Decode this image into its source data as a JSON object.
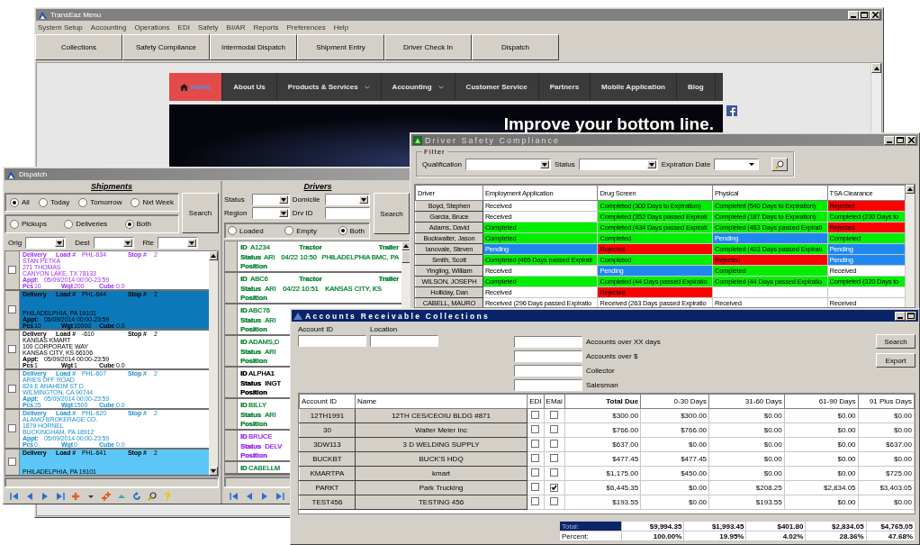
{
  "main_window": {
    "title": "TransEaz Menu",
    "menu": [
      "System Setup",
      "Accounting",
      "Operations",
      "EDI",
      "Safety",
      "BI/AR",
      "Reports",
      "Preferences",
      "Help"
    ],
    "toolbar": [
      "Collections",
      "Safety Compliance",
      "Intermodal Dispatch",
      "Shipment Entry",
      "Driver Check In",
      "Dispatch"
    ],
    "website": {
      "nav": [
        {
          "label": "Home",
          "selected": true,
          "dropdown": false
        },
        {
          "label": "About Us",
          "selected": false,
          "dropdown": false
        },
        {
          "label": "Products & Services",
          "selected": false,
          "dropdown": true
        },
        {
          "label": "Accounting",
          "selected": false,
          "dropdown": true
        },
        {
          "label": "Customer Service",
          "selected": false,
          "dropdown": false
        },
        {
          "label": "Partners",
          "selected": false,
          "dropdown": false
        },
        {
          "label": "Mobile Application",
          "selected": false,
          "dropdown": false
        },
        {
          "label": "Blog",
          "selected": false,
          "dropdown": false
        }
      ],
      "banner_text": "Improve your bottom line."
    }
  },
  "dispatch": {
    "title": "Dispatch",
    "shipments": {
      "heading": "Shipments",
      "date_options": [
        {
          "label": "All",
          "selected": true
        },
        {
          "label": "Today",
          "selected": false
        },
        {
          "label": "Tomorrow",
          "selected": false
        },
        {
          "label": "Nxt Week",
          "selected": false
        }
      ],
      "type_options": [
        {
          "label": "Pickups",
          "selected": false
        },
        {
          "label": "Deliveries",
          "selected": false
        },
        {
          "label": "Both",
          "selected": true
        }
      ],
      "search_button": "Search",
      "filters": [
        "Orig",
        "Dest",
        "Rte"
      ],
      "rows": [
        {
          "color": "#9b2ff0",
          "selected": false,
          "flagged": false,
          "checked": false,
          "type": "Delivery",
          "load_label": "Load #",
          "load": "PHL-634",
          "stop_label": "Stop #",
          "stop": "2",
          "address": [
            "STAN PETKA",
            "271 THOMAS",
            "CANYON LAKE, TX 78133"
          ],
          "appt_label": "Appt:",
          "appt": "05/09/2014 00:00-23:59",
          "pcs_label": "Pcs",
          "pcs": "10",
          "wgt_label": "Wgt",
          "wgt": "200",
          "cube_label": "Cube",
          "cube": "0.0"
        },
        {
          "selected": true,
          "flagged": false,
          "checked": false,
          "type": "Delivery",
          "load_label": "Load #",
          "load": "PHL-644",
          "stop_label": "Stop #",
          "stop": "2",
          "address": [
            "PHILADELPHIA, PA 19101"
          ],
          "appt_label": "Appt:",
          "appt": "05/09/2014 00:00-23:59",
          "pcs_label": "Pcs",
          "pcs": "10",
          "wgt_label": "Wgt",
          "wgt": "10000",
          "cube_label": "Cube",
          "cube": "0.0"
        },
        {
          "color": "#000000",
          "selected": false,
          "flagged": false,
          "checked": false,
          "type": "Delivery",
          "load_label": "Load #",
          "load": "-610",
          "stop_label": "Stop #",
          "stop": "2",
          "address": [
            "KANSAS KMART",
            "100 CORPORATE WAY",
            "KANSAS CITY, KS 66106"
          ],
          "appt_label": "Appt:",
          "appt": "05/09/2014 00:00-23:59",
          "pcs_label": "Pcs",
          "pcs": "1",
          "wgt_label": "Wgt",
          "wgt": "1",
          "cube_label": "Cube",
          "cube": "0.0"
        },
        {
          "color": "#1c8fd0",
          "selected": false,
          "flagged": false,
          "checked": false,
          "type": "Delivery",
          "load_label": "Load #",
          "load": "PHL-607",
          "stop_label": "Stop #",
          "stop": "2",
          "address": [
            "ARIES OFF ROAD",
            "824 E ANAHEIM ST D",
            "WILMINGTON, CA 90744"
          ],
          "appt_label": "Appt:",
          "appt": "05/09/2014 00:00-23:59",
          "pcs_label": "Pcs",
          "pcs": "25",
          "wgt_label": "Wgt",
          "wgt": "1500",
          "cube_label": "Cube",
          "cube": "0.0"
        },
        {
          "color": "#1c8fd0",
          "selected": false,
          "flagged": false,
          "checked": false,
          "type": "Delivery",
          "load_label": "Load #",
          "load": "PHL-620",
          "stop_label": "Stop #",
          "stop": "2",
          "address": [
            "ALAMO BROKERAGE CO.",
            "1879 HORNEL",
            "BUCKINGHAM, PA 18912"
          ],
          "appt_label": "Appt:",
          "appt": "05/09/2014 00:00-23:59",
          "pcs_label": "Pcs",
          "pcs": "0",
          "wgt_label": "Wgt",
          "wgt": "0",
          "cube_label": "Cube",
          "cube": "0.0"
        },
        {
          "selected": false,
          "flagged": true,
          "checked": false,
          "type": "Delivery",
          "load_label": "Load #",
          "load": "PHL-641",
          "stop_label": "Stop #",
          "stop": "2",
          "address": [
            "PHILADELPHIA, PA 19101"
          ]
        }
      ]
    },
    "drivers": {
      "heading": "Drivers",
      "fields": [
        {
          "label": "Status",
          "kind": "combo"
        },
        {
          "label": "Domicile",
          "kind": "combo"
        },
        {
          "label": "Region",
          "kind": "combo"
        },
        {
          "label": "Drv ID",
          "kind": "text"
        }
      ],
      "search_button": "Search",
      "load_options": [
        {
          "label": "Loaded",
          "selected": false
        },
        {
          "label": "Empty",
          "selected": false
        },
        {
          "label": "Both",
          "selected": true
        }
      ],
      "rows": [
        {
          "color": "#128a3a",
          "id_label": "ID",
          "id": "A1234",
          "tractor_label": "Tractor",
          "trailer_label": "Trailer",
          "status_label": "Status",
          "status": "ARI",
          "time": "04/22 10:50",
          "location": "PHILADELPHIA BMC, PA",
          "position_label": "Position"
        },
        {
          "color": "#128a3a",
          "id_label": "ID",
          "id": "ABC6",
          "tractor_label": "Tractor",
          "trailer_label": "Trailer",
          "status_label": "Status",
          "status": "ARI",
          "time": "04/22 10:51",
          "location": "KANSAS CITY, KS",
          "position_label": "Position"
        },
        {
          "color": "#128a3a",
          "id_label": "ID",
          "id": "ABC76",
          "status_label": "Status",
          "status": "ARI",
          "position_label": "Position"
        },
        {
          "color": "#128a3a",
          "id_label": "ID",
          "id": "ADAMS,D",
          "status_label": "Status",
          "status": "ARI",
          "position_label": "Position"
        },
        {
          "color": "#000000",
          "id_label": "ID",
          "id": "ALPHA1",
          "status_label": "Status",
          "status": "INGT",
          "position_label": "Position"
        },
        {
          "color": "#128a3a",
          "id_label": "ID",
          "id": "BILLY",
          "status_label": "Status",
          "status": "ARI",
          "position_label": "Position"
        },
        {
          "color": "#9b2ff0",
          "id_label": "ID",
          "id": "BRUCE",
          "status_label": "Status",
          "status": "DELV",
          "position_label": "Position"
        },
        {
          "color": "#128a3a",
          "id_label": "ID",
          "id": "CABELLM"
        }
      ]
    }
  },
  "safety_compliance": {
    "title": "Driver Safety Compliance",
    "filter_label": "Filter",
    "filters": [
      {
        "label": "Qualification",
        "kind": "combo"
      },
      {
        "label": "Status",
        "kind": "combo"
      },
      {
        "label": "Expiration Date",
        "kind": "date"
      }
    ],
    "columns": [
      "Driver",
      "Employment Application",
      "Drug Screen",
      "Physical",
      "TSA Clearance"
    ],
    "rows": [
      {
        "cells": [
          {
            "kind": "driver",
            "text": "Boyd, Stephen"
          },
          {
            "kind": "status",
            "text": "Received",
            "color": "#ffffff"
          },
          {
            "kind": "status",
            "text": "Completed (300 Days to Expiration)",
            "color": "#00ee00"
          },
          {
            "kind": "status",
            "text": "Completed (540 Days to Expiration)",
            "color": "#00ee00"
          },
          {
            "kind": "status",
            "text": "Rejected",
            "color": "#ff0000"
          }
        ]
      },
      {
        "cells": [
          {
            "kind": "driver",
            "text": "Garcia, Bruce"
          },
          {
            "kind": "status",
            "text": "Received",
            "color": "#ffffff"
          },
          {
            "kind": "status",
            "text": "Completed (352 Days passed Expirati",
            "color": "#00ee00"
          },
          {
            "kind": "status",
            "text": "Completed (187 Days to Expiration)",
            "color": "#00ee00"
          },
          {
            "kind": "status",
            "text": "Completed (230 Days to",
            "color": "#00ee00"
          }
        ]
      },
      {
        "cells": [
          {
            "kind": "driver",
            "text": "Adams, David"
          },
          {
            "kind": "status",
            "text": "Completed",
            "color": "#00ee00"
          },
          {
            "kind": "status",
            "text": "Completed (434 Days passed Expirati",
            "color": "#00ee00"
          },
          {
            "kind": "status",
            "text": "Completed (463 Days passed Expirati",
            "color": "#00ee00"
          },
          {
            "kind": "status",
            "text": "Rejected",
            "color": "#ff0000"
          }
        ]
      },
      {
        "cells": [
          {
            "kind": "driver",
            "text": "Buckwalter, Jason"
          },
          {
            "kind": "status",
            "text": "Completed",
            "color": "#00ee00"
          },
          {
            "kind": "status",
            "text": "Completed",
            "color": "#00ee00"
          },
          {
            "kind": "status",
            "text": "Pending",
            "color": "#1e88f0"
          },
          {
            "kind": "status",
            "text": "Completed",
            "color": "#00ee00"
          }
        ]
      },
      {
        "cells": [
          {
            "kind": "driver",
            "text": "Ianovale, Steven"
          },
          {
            "kind": "status",
            "text": "Pending",
            "color": "#1e88f0"
          },
          {
            "kind": "status",
            "text": "Rejected",
            "color": "#ff0000"
          },
          {
            "kind": "status",
            "text": "Completed (403 Days passed Expirati",
            "color": "#00ee00"
          },
          {
            "kind": "status",
            "text": "Pending",
            "color": "#1e88f0"
          }
        ]
      },
      {
        "cells": [
          {
            "kind": "driver",
            "text": "Smith, Scott"
          },
          {
            "kind": "status",
            "text": "Completed (465 Days passed Expirati",
            "color": "#00ee00"
          },
          {
            "kind": "status",
            "text": "Completed",
            "color": "#00ee00"
          },
          {
            "kind": "status",
            "text": "Rejected",
            "color": "#ff0000"
          },
          {
            "kind": "status",
            "text": "Pending",
            "color": "#1e88f0"
          }
        ]
      },
      {
        "cells": [
          {
            "kind": "driver",
            "text": "Yingling, William"
          },
          {
            "kind": "status",
            "text": "Received",
            "color": "#ffffff"
          },
          {
            "kind": "status",
            "text": "Pending",
            "color": "#1e88f0"
          },
          {
            "kind": "status",
            "text": "Completed",
            "color": "#00ee00"
          },
          {
            "kind": "status",
            "text": "Received",
            "color": "#ffffff"
          }
        ]
      },
      {
        "cells": [
          {
            "kind": "driver",
            "text": "WILSON, JOSEPH"
          },
          {
            "kind": "status",
            "text": "Completed",
            "color": "#00ee00"
          },
          {
            "kind": "status",
            "text": "Completed (44 Days passed Expiratio",
            "color": "#00ee00"
          },
          {
            "kind": "status",
            "text": "Completed (44 Days passed Expiratio",
            "color": "#00ee00"
          },
          {
            "kind": "status",
            "text": "Completed (320 Days to",
            "color": "#00ee00"
          }
        ]
      },
      {
        "cells": [
          {
            "kind": "driver",
            "text": "Holliday, Dan"
          },
          {
            "kind": "status",
            "text": "Received",
            "color": "#ffffff"
          },
          {
            "kind": "status",
            "text": "Rejected",
            "color": "#ff0000"
          },
          {
            "kind": "status",
            "color": "#ffffff"
          },
          {
            "kind": "status",
            "color": "#ffffff"
          }
        ]
      },
      {
        "cells": [
          {
            "kind": "driver",
            "text": "CABELL, MAURO"
          },
          {
            "kind": "status",
            "text": "Received (296 Days passed Expiratio",
            "color": "#ffffff"
          },
          {
            "kind": "status",
            "text": "Received (263 Days passed Expiratio",
            "color": "#ffffff"
          },
          {
            "kind": "status",
            "text": "Received",
            "color": "#ffffff"
          },
          {
            "kind": "status",
            "text": "Received",
            "color": "#ffffff"
          }
        ]
      }
    ]
  },
  "receivables": {
    "title": "Accounts Receivable Collections",
    "fields": [
      "Account ID",
      "Location"
    ],
    "criteria": [
      "Accounts over XX days",
      "Accounts over $",
      "Collector",
      "Salesman"
    ],
    "buttons": [
      "Search",
      "Export"
    ],
    "columns": [
      "Account ID",
      "Name",
      "EDI",
      "EMai",
      "Total Due",
      "0-30 Days",
      "31-60 Days",
      "61-90 Days",
      "91 Plus Days"
    ],
    "rows": [
      {
        "account": "12TH1991",
        "name": "12TH CES/CEOIU BLDG #871",
        "edi": false,
        "email": false,
        "values": [
          "$300.00",
          "$300.00",
          "$0.00",
          "$0.00",
          "$0.00"
        ]
      },
      {
        "account": "30",
        "name": "Walter Meier Inc",
        "edi": false,
        "email": false,
        "values": [
          "$766.00",
          "$766.00",
          "$0.00",
          "$0.00",
          "$0.00"
        ]
      },
      {
        "account": "3DW113",
        "name": "3 D WELDING SUPPLY",
        "edi": false,
        "email": false,
        "values": [
          "$637.00",
          "$0.00",
          "$0.00",
          "$0.00",
          "$637.00"
        ]
      },
      {
        "account": "BUCKBT",
        "name": "BUCK'S HDQ",
        "edi": false,
        "email": false,
        "values": [
          "$477.45",
          "$477.45",
          "$0.00",
          "$0.00",
          "$0.00"
        ]
      },
      {
        "account": "KMARTPA",
        "name": "kmart",
        "edi": false,
        "email": false,
        "values": [
          "$1,175.00",
          "$450.00",
          "$0.00",
          "$0.00",
          "$725.00"
        ]
      },
      {
        "account": "PARKT",
        "name": "Park Trucking",
        "edi": false,
        "email": true,
        "values": [
          "$6,445.35",
          "$0.00",
          "$208.25",
          "$2,834.05",
          "$3,403.05"
        ]
      },
      {
        "account": "TEST456",
        "name": "TESTING 456",
        "edi": false,
        "email": false,
        "values": [
          "$193.55",
          "$0.00",
          "$193.55",
          "$0.00",
          "$0.00"
        ]
      }
    ],
    "totals": [
      {
        "label": "Total:",
        "selected": true,
        "values": [
          "$9,994.35",
          "$1,993.45",
          "$401.80",
          "$2,834.05",
          "$4,765.05"
        ]
      },
      {
        "label": "Percent:",
        "selected": false,
        "values": [
          "100.00%",
          "19.95%",
          "4.02%",
          "28.36%",
          "47.68%"
        ]
      }
    ]
  }
}
